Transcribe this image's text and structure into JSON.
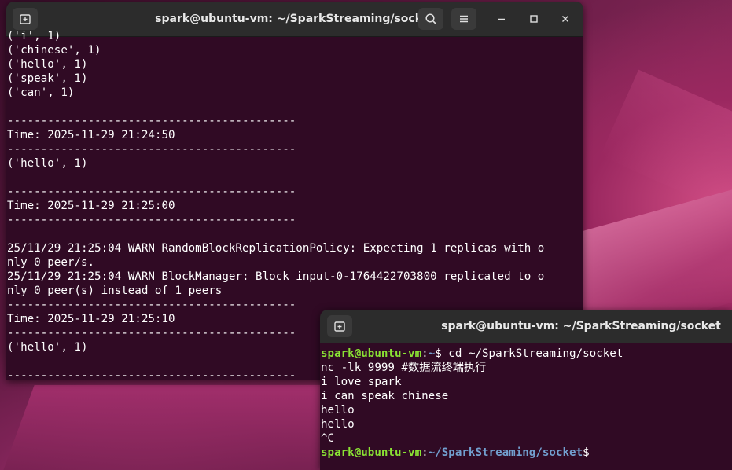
{
  "colors": {
    "terminal_bg": "#300a24",
    "titlebar_bg": "#2c2c2c",
    "prompt_user": "#8ae234",
    "prompt_path": "#729fcf",
    "text": "#ffffff"
  },
  "main_terminal": {
    "title": "spark@ubuntu-vm: ~/SparkStreaming/socket",
    "new_tab_icon": "new-tab-icon",
    "search_icon": "search-icon",
    "menu_icon": "hamburger-menu-icon",
    "minimize_icon": "minimize-icon",
    "maximize_icon": "maximize-icon",
    "close_icon": "close-icon",
    "lines": [
      "('i', 1)",
      "('chinese', 1)",
      "('hello', 1)",
      "('speak', 1)",
      "('can', 1)",
      "",
      "-------------------------------------------",
      "Time: 2025-11-29 21:24:50",
      "-------------------------------------------",
      "('hello', 1)",
      "",
      "-------------------------------------------",
      "Time: 2025-11-29 21:25:00",
      "-------------------------------------------",
      "",
      "25/11/29 21:25:04 WARN RandomBlockReplicationPolicy: Expecting 1 replicas with o",
      "nly 0 peer/s.",
      "25/11/29 21:25:04 WARN BlockManager: Block input-0-1764422703800 replicated to o",
      "nly 0 peer(s) instead of 1 peers",
      "-------------------------------------------",
      "Time: 2025-11-29 21:25:10",
      "-------------------------------------------",
      "('hello', 1)",
      "",
      "-------------------------------------------"
    ]
  },
  "second_terminal": {
    "title": "spark@ubuntu-vm: ~/SparkStreaming/socket",
    "new_tab_icon": "new-tab-icon",
    "prompt_user": "spark@ubuntu-vm",
    "prompt_sep": ":",
    "prompt_path": "~",
    "prompt_path_full": "~/SparkStreaming/socket",
    "prompt_dollar": "$",
    "command1": " cd ~/SparkStreaming/socket",
    "output_lines": [
      "nc -lk 9999 #数据流终端执行",
      "i love spark",
      "i can speak chinese",
      "hello",
      "hello",
      "^C"
    ]
  }
}
